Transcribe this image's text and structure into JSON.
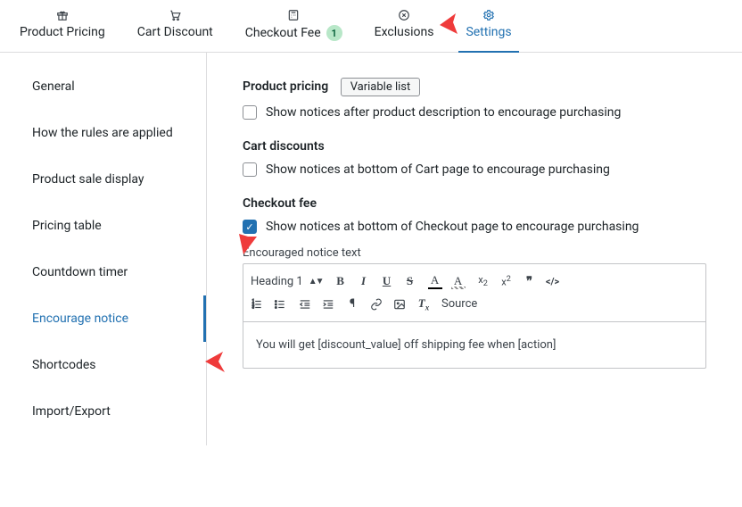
{
  "tabs": [
    {
      "label": "Product Pricing",
      "icon": "gift"
    },
    {
      "label": "Cart Discount",
      "icon": "cart"
    },
    {
      "label": "Checkout Fee",
      "icon": "calc",
      "badge": "1"
    },
    {
      "label": "Exclusions",
      "icon": "x"
    },
    {
      "label": "Settings",
      "icon": "gear",
      "active": true
    }
  ],
  "sidebar": [
    {
      "label": "General"
    },
    {
      "label": "How the rules are applied"
    },
    {
      "label": "Product sale display"
    },
    {
      "label": "Pricing table"
    },
    {
      "label": "Countdown timer"
    },
    {
      "label": "Encourage notice",
      "active": true
    },
    {
      "label": "Shortcodes"
    },
    {
      "label": "Import/Export"
    }
  ],
  "main": {
    "product_pricing": {
      "title": "Product pricing",
      "variable_btn": "Variable list",
      "check_label": "Show notices after product description to encourage purchasing"
    },
    "cart_discounts": {
      "title": "Cart discounts",
      "check_label": "Show notices at bottom of Cart page to encourage purchasing"
    },
    "checkout_fee": {
      "title": "Checkout fee",
      "check_label": "Show notices at bottom of Checkout page to encourage purchasing",
      "editor_label": "Encouraged notice text",
      "heading_select": "Heading 1",
      "source_label": "Source",
      "body": "You will get [discount_value] off shipping fee when [action]"
    }
  }
}
